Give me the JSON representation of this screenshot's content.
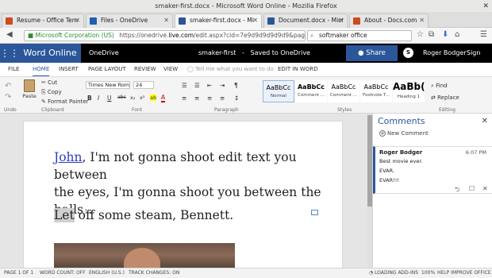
{
  "window": {
    "title": "smaker-first.docx - Microsoft Word Online - Mozilla Firefox",
    "close_glyph": "✕"
  },
  "tabs": [
    {
      "label": "Resume - Office Tem",
      "color": "#d04a1e"
    },
    {
      "label": "Files - OneDrive",
      "color": "#1f5fb4"
    },
    {
      "label": "smaker-first.docx - Mi",
      "color": "#2b579a"
    },
    {
      "label": "Document.docx - Micr",
      "color": "#2b579a"
    },
    {
      "label": "About - Docs.com",
      "color": "#d04a1e"
    }
  ],
  "tab_close_glyph": "✕",
  "navbar": {
    "back_glyph": "◀",
    "org": "Microsoft Corporation (US)",
    "url_prefix": "https://onedrive.",
    "url_domain": "live.com",
    "url_suffix": "/edit.aspx?cid=7e9d9d9d9d9d9&page=view",
    "search_value": "softmaker office",
    "search_glyph": "⌕",
    "icons": [
      "☆",
      "⧉",
      "⬇",
      "⌂",
      "☰"
    ]
  },
  "appbar": {
    "app_name": "Word Online",
    "waffle_glyph": "⋮⋮⋮",
    "location": "OneDrive",
    "doc_name": "smaker-first",
    "sep": "-",
    "save_status": "Saved to OneDrive",
    "share_label": "Share",
    "skype_glyph": "S",
    "user": "Roger Bodger",
    "signout": "Sign out"
  },
  "ribbon_tabs": [
    "FILE",
    "HOME",
    "INSERT",
    "PAGE LAYOUT",
    "REVIEW",
    "VIEW"
  ],
  "tell_me": "Tell me what you want to do",
  "edit_in_word": "EDIT IN WORD",
  "ribbon": {
    "undo_glyph": "↶",
    "redo_glyph": "↷",
    "paste": "Paste",
    "cut": "Cut",
    "copy": "Copy",
    "format_painter": "Format Painter",
    "font_name": "Times New Roman",
    "font_size": "24",
    "format_buttons": [
      "B",
      "I",
      "U",
      "abc",
      "x₂",
      "x²",
      "ab",
      "A"
    ],
    "groups": [
      "Undo",
      "Clipboard",
      "Font",
      "Paragraph",
      "Styles",
      "Editing"
    ],
    "styles": [
      {
        "sample": "AaBbCc",
        "name": "Normal"
      },
      {
        "sample": "AaBbCc",
        "name": "Comment ..."
      },
      {
        "sample": "AaBbCc",
        "name": "Comment ..."
      },
      {
        "sample": "AaBbCc",
        "name": "Footnote T..."
      },
      {
        "sample": "AaBb(",
        "name": "Heading 1"
      }
    ],
    "find": "Find",
    "replace": "Replace"
  },
  "document": {
    "para1_link": "John",
    "para1_line1": ", I'm not gonna shoot edit text you between",
    "para1_line2": "the eyes, I'm gonna shoot you between the balls",
    "para1_end": ".",
    "para2_highlight": "Let",
    "para2_rest": " off some steam, Bennett."
  },
  "comments_pane": {
    "title": "Comments",
    "close_glyph": "✕",
    "new_comment": "New Comment",
    "card": {
      "author": "Roger Bodger",
      "time": "6:07 PM",
      "lines": [
        "Best movie ever.",
        "EVAR.",
        "EVAR!!!"
      ],
      "action_glyphs": [
        "⮌",
        "☐",
        "✕"
      ]
    }
  },
  "status_bar": {
    "page": "PAGE 1 OF 1",
    "word_count": "WORD COUNT: OFF",
    "language": "ENGLISH (U.S.)",
    "track_changes": "TRACK CHANGES: ON",
    "addins": "LOADING ADD-INS",
    "zoom": "100%",
    "help": "HELP IMPROVE OFFICE"
  }
}
